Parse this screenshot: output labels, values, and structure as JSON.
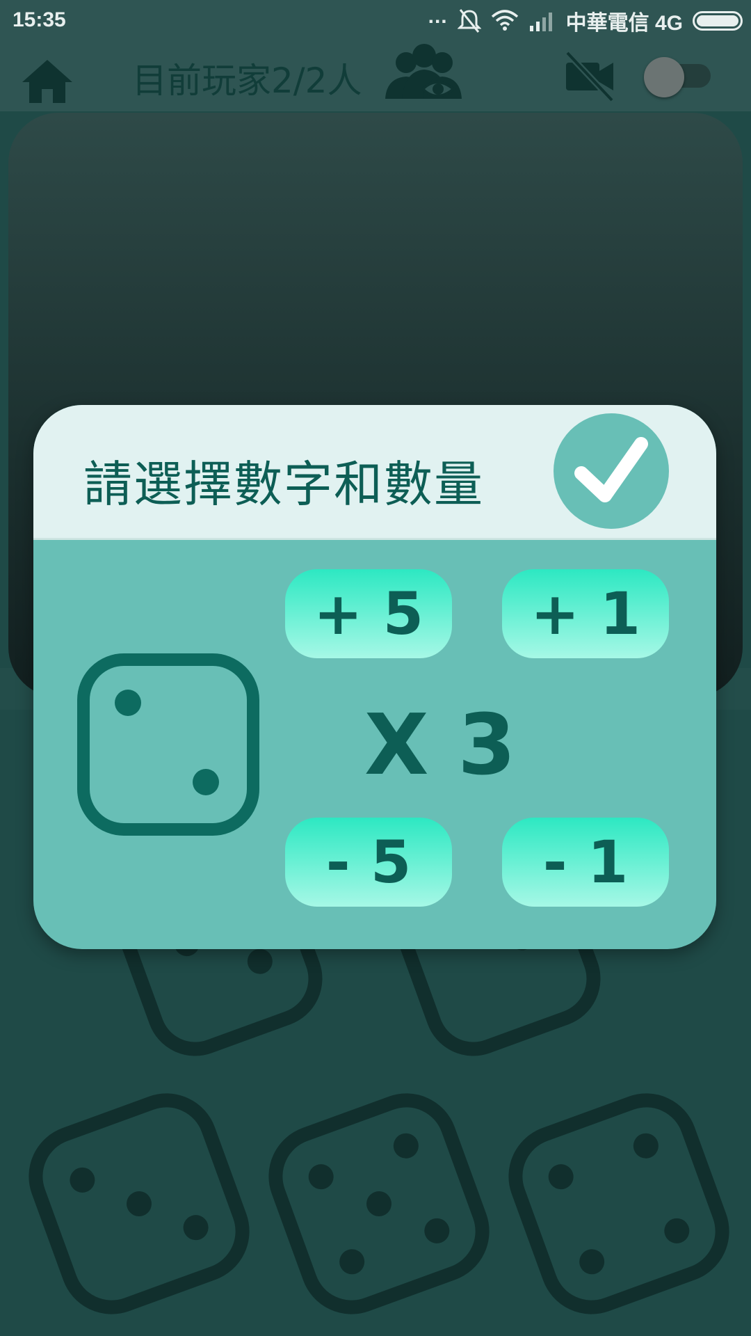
{
  "status_bar": {
    "time": "15:35",
    "dots": "...",
    "carrier": "中華電信 4G",
    "icons": [
      "bell-muted-icon",
      "wifi-icon",
      "signal-icon",
      "battery-icon"
    ]
  },
  "top_bar": {
    "players_text": "目前玩家2/2人",
    "icons": [
      "home-icon",
      "spectator-eye-icon",
      "camera-off-icon"
    ],
    "toggle_on": false
  },
  "dialog": {
    "title": "請選擇數字和數量",
    "confirm_icon": "checkmark-icon",
    "selected_die_face": 2,
    "quantity_text": "X 3",
    "buttons": {
      "plus5": "+ 5",
      "plus1": "+ 1",
      "minus5": "- 5",
      "minus1": "- 1"
    }
  },
  "background_dice_faces": [
    2,
    2,
    3,
    5,
    4
  ],
  "colors": {
    "accent": "#68bfb6",
    "header": "#e1f2f1",
    "text_dark": "#0d5e55",
    "button_top": "#2de8c2",
    "button_bottom": "#a6f8e6"
  }
}
